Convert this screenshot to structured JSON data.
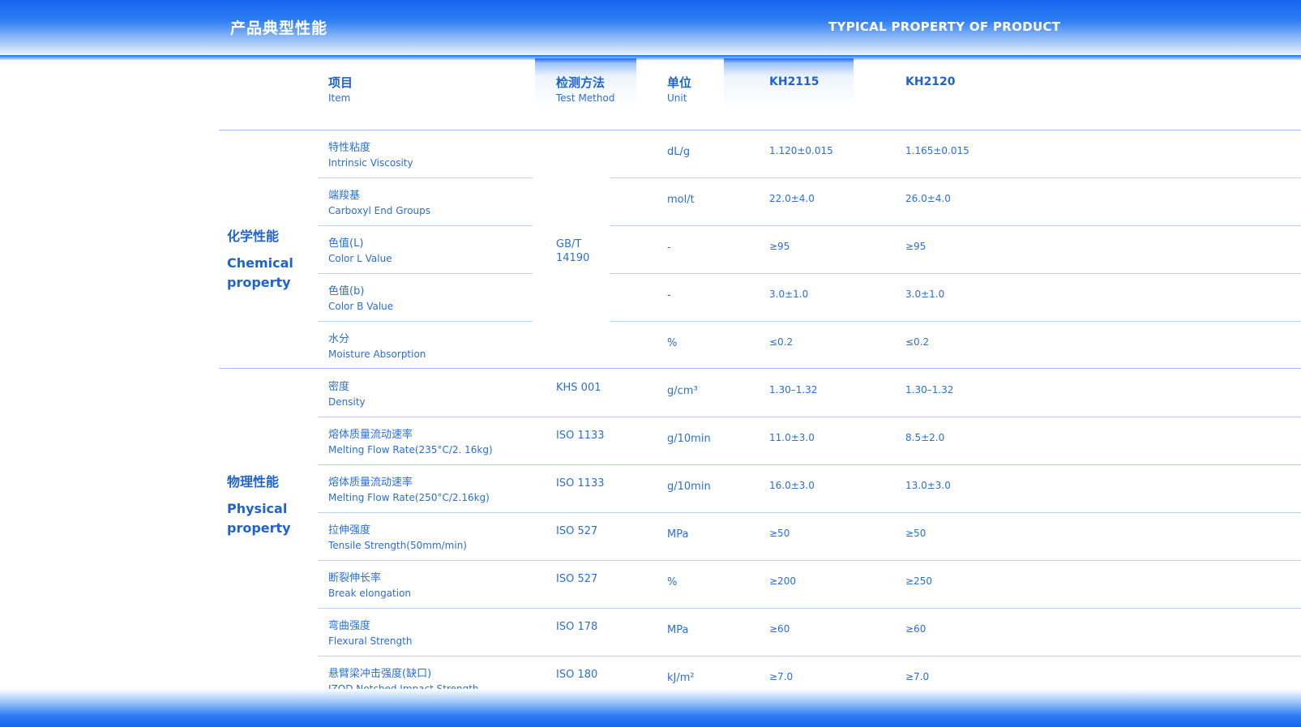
{
  "header": {
    "title_cn": "产品典型性能",
    "title_en": "TYPICAL PROPERTY OF PRODUCT"
  },
  "columns": {
    "item": {
      "cn": "项目",
      "en": "Item"
    },
    "method": {
      "cn": "检测方法",
      "en": "Test Method"
    },
    "unit": {
      "cn": "单位",
      "en": "Unit"
    },
    "kh2115": "KH2115",
    "kh2120": "KH2120"
  },
  "groups": {
    "chemical": {
      "cn": "化学性能",
      "en": "Chemical property"
    },
    "physical": {
      "cn": "物理性能",
      "en": "Physical property"
    }
  },
  "chemical_method": "GB/T 14190",
  "rows": [
    {
      "cn": "特性粘度",
      "en": "Intrinsic Viscosity",
      "method": "",
      "unit": "dL/g",
      "kh2115": "1.120±0.015",
      "kh2120": "1.165±0.015"
    },
    {
      "cn": "端羧基",
      "en": "Carboxyl End Groups",
      "method": "",
      "unit": "mol/t",
      "kh2115": "22.0±4.0",
      "kh2120": "26.0±4.0"
    },
    {
      "cn": "色值(L)",
      "en": "Color L Value",
      "method": "",
      "unit": "-",
      "kh2115": "≥95",
      "kh2120": "≥95"
    },
    {
      "cn": "色值(b)",
      "en": "Color B Value",
      "method": "",
      "unit": "-",
      "kh2115": "3.0±1.0",
      "kh2120": "3.0±1.0"
    },
    {
      "cn": "水分",
      "en": "Moisture Absorption",
      "method": "",
      "unit": "%",
      "kh2115": "≤0.2",
      "kh2120": "≤0.2"
    },
    {
      "cn": "密度",
      "en": "Density",
      "method": "KHS 001",
      "unit": "g/cm³",
      "kh2115": "1.30–1.32",
      "kh2120": "1.30–1.32"
    },
    {
      "cn": "熔体质量流动速率",
      "en": "Melting Flow Rate(235°C/2. 16kg)",
      "method": "ISO 1133",
      "unit": "g/10min",
      "kh2115": "11.0±3.0",
      "kh2120": "8.5±2.0"
    },
    {
      "cn": "熔体质量流动速率",
      "en": "Melting Flow Rate(250°C/2.16kg)",
      "method": "ISO 1133",
      "unit": "g/10min",
      "kh2115": "16.0±3.0",
      "kh2120": "13.0±3.0"
    },
    {
      "cn": "拉伸强度",
      "en": "Tensile Strength(50mm/min)",
      "method": "ISO 527",
      "unit": "MPa",
      "kh2115": "≥50",
      "kh2120": "≥50"
    },
    {
      "cn": "断裂伸长率",
      "en": "Break elongation",
      "method": "ISO 527",
      "unit": "%",
      "kh2115": "≥200",
      "kh2120": "≥250"
    },
    {
      "cn": "弯曲强度",
      "en": "Flexural Strength",
      "method": "ISO 178",
      "unit": "MPa",
      "kh2115": "≥60",
      "kh2120": "≥60"
    },
    {
      "cn": "悬臂梁冲击强度(缺口)",
      "en": "IZOD Notched Impact Strength",
      "method": "ISO 180",
      "unit": "kJ/m²",
      "kh2115": "≥7.0",
      "kh2120": "≥7.0"
    }
  ]
}
